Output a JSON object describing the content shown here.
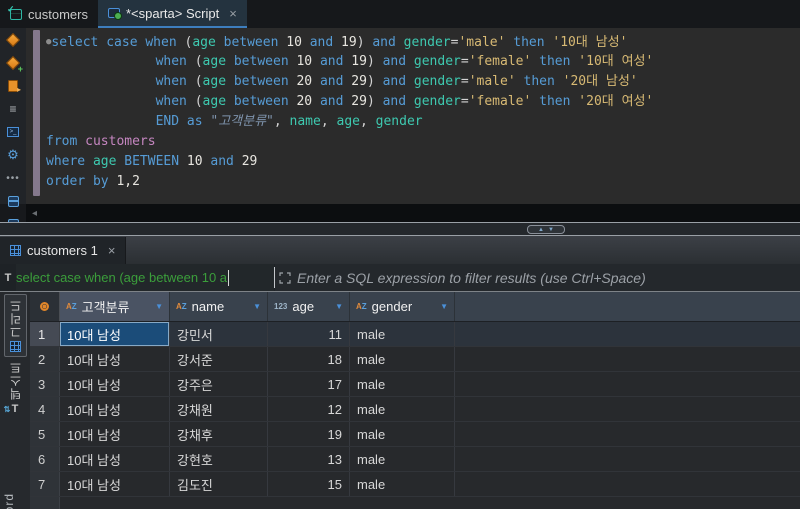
{
  "ui": {
    "close_glyph": "×"
  },
  "colors": {
    "accent_blue": "#3d7ebe",
    "keyword": "#569cd6",
    "identifier": "#3ec9b0",
    "string": "#d8ba74",
    "table_name": "#c586c0",
    "filter_preview_green": "#3b9e3b",
    "selected_cell_blue": "#1b4c79",
    "execute_orange": "#e8922a"
  },
  "editor": {
    "tabs": [
      {
        "label": "customers",
        "active": false
      },
      {
        "label": "*<sparta> Script",
        "active": true
      }
    ],
    "sql_lines": [
      {
        "tokens": [
          {
            "c": "mk",
            "t": "●"
          },
          {
            "c": "k",
            "t": "select case when "
          },
          {
            "c": "p",
            "t": "("
          },
          {
            "c": "i",
            "t": "age"
          },
          {
            "c": "k",
            "t": " between "
          },
          {
            "c": "n",
            "t": "10"
          },
          {
            "c": "k",
            "t": " and "
          },
          {
            "c": "n",
            "t": "19"
          },
          {
            "c": "p",
            "t": ") "
          },
          {
            "c": "k",
            "t": "and "
          },
          {
            "c": "i",
            "t": "gender"
          },
          {
            "c": "p",
            "t": "="
          },
          {
            "c": "s",
            "t": "'male'"
          },
          {
            "c": "k",
            "t": " then "
          },
          {
            "c": "s",
            "t": "'10대 남성'"
          }
        ]
      },
      {
        "tokens": [
          {
            "c": "p",
            "t": "              "
          },
          {
            "c": "k",
            "t": "when "
          },
          {
            "c": "p",
            "t": "("
          },
          {
            "c": "i",
            "t": "age"
          },
          {
            "c": "k",
            "t": " between "
          },
          {
            "c": "n",
            "t": "10"
          },
          {
            "c": "k",
            "t": " and "
          },
          {
            "c": "n",
            "t": "19"
          },
          {
            "c": "p",
            "t": ") "
          },
          {
            "c": "k",
            "t": "and "
          },
          {
            "c": "i",
            "t": "gender"
          },
          {
            "c": "p",
            "t": "="
          },
          {
            "c": "s",
            "t": "'female'"
          },
          {
            "c": "k",
            "t": " then "
          },
          {
            "c": "s",
            "t": "'10대 여성'"
          }
        ]
      },
      {
        "tokens": [
          {
            "c": "p",
            "t": "              "
          },
          {
            "c": "k",
            "t": "when "
          },
          {
            "c": "p",
            "t": "("
          },
          {
            "c": "i",
            "t": "age"
          },
          {
            "c": "k",
            "t": " between "
          },
          {
            "c": "n",
            "t": "20"
          },
          {
            "c": "k",
            "t": " and "
          },
          {
            "c": "n",
            "t": "29"
          },
          {
            "c": "p",
            "t": ") "
          },
          {
            "c": "k",
            "t": "and "
          },
          {
            "c": "i",
            "t": "gender"
          },
          {
            "c": "p",
            "t": "="
          },
          {
            "c": "s",
            "t": "'male'"
          },
          {
            "c": "k",
            "t": " then "
          },
          {
            "c": "s",
            "t": "'20대 남성'"
          }
        ]
      },
      {
        "tokens": [
          {
            "c": "p",
            "t": "              "
          },
          {
            "c": "k",
            "t": "when "
          },
          {
            "c": "p",
            "t": "("
          },
          {
            "c": "i",
            "t": "age"
          },
          {
            "c": "k",
            "t": " between "
          },
          {
            "c": "n",
            "t": "20"
          },
          {
            "c": "k",
            "t": " and "
          },
          {
            "c": "n",
            "t": "29"
          },
          {
            "c": "p",
            "t": ") "
          },
          {
            "c": "k",
            "t": "and "
          },
          {
            "c": "i",
            "t": "gender"
          },
          {
            "c": "p",
            "t": "="
          },
          {
            "c": "s",
            "t": "'female'"
          },
          {
            "c": "k",
            "t": " then "
          },
          {
            "c": "s",
            "t": "'20대 여성'"
          }
        ]
      },
      {
        "tokens": [
          {
            "c": "p",
            "t": "              "
          },
          {
            "c": "k",
            "t": "END as "
          },
          {
            "c": "q",
            "t": "\"고객분류\""
          },
          {
            "c": "p",
            "t": ", "
          },
          {
            "c": "i",
            "t": "name"
          },
          {
            "c": "p",
            "t": ", "
          },
          {
            "c": "i",
            "t": "age"
          },
          {
            "c": "p",
            "t": ", "
          },
          {
            "c": "i",
            "t": "gender"
          }
        ]
      },
      {
        "tokens": [
          {
            "c": "k",
            "t": "from "
          },
          {
            "c": "t",
            "t": "customers"
          }
        ]
      },
      {
        "tokens": [
          {
            "c": "k",
            "t": "where "
          },
          {
            "c": "i",
            "t": "age"
          },
          {
            "c": "k",
            "t": " BETWEEN "
          },
          {
            "c": "n",
            "t": "10"
          },
          {
            "c": "k",
            "t": " and "
          },
          {
            "c": "n",
            "t": "29"
          }
        ]
      },
      {
        "tokens": [
          {
            "c": "k",
            "t": "order by "
          },
          {
            "c": "n",
            "t": "1,2"
          }
        ]
      }
    ]
  },
  "results": {
    "tab_label": "customers 1",
    "filter": {
      "preview": "select case when (age between 10 a",
      "placeholder": "Enter a SQL expression to filter results (use Ctrl+Space)"
    },
    "side_tabs": [
      {
        "label": "그리드",
        "active": true
      },
      {
        "label": "텍스트",
        "active": false
      }
    ],
    "side_partial_label": "ord",
    "type_icons": {
      "az": [
        "A",
        "Z"
      ],
      "123": "123"
    },
    "columns": [
      {
        "label": "고객분류",
        "type": "az",
        "selected": true
      },
      {
        "label": "name",
        "type": "az",
        "selected": false
      },
      {
        "label": "age",
        "type": "123",
        "selected": false
      },
      {
        "label": "gender",
        "type": "az",
        "selected": false
      }
    ],
    "rows": [
      {
        "num": "1",
        "values": [
          "10대 남성",
          "강민서",
          "11",
          "male"
        ],
        "selected": true
      },
      {
        "num": "2",
        "values": [
          "10대 남성",
          "강서준",
          "18",
          "male"
        ],
        "selected": false
      },
      {
        "num": "3",
        "values": [
          "10대 남성",
          "강주은",
          "17",
          "male"
        ],
        "selected": false
      },
      {
        "num": "4",
        "values": [
          "10대 남성",
          "강채원",
          "12",
          "male"
        ],
        "selected": false
      },
      {
        "num": "5",
        "values": [
          "10대 남성",
          "강채후",
          "19",
          "male"
        ],
        "selected": false
      },
      {
        "num": "6",
        "values": [
          "10대 남성",
          "강현호",
          "13",
          "male"
        ],
        "selected": false
      },
      {
        "num": "7",
        "values": [
          "10대 남성",
          "김도진",
          "15",
          "male"
        ],
        "selected": false
      }
    ]
  }
}
